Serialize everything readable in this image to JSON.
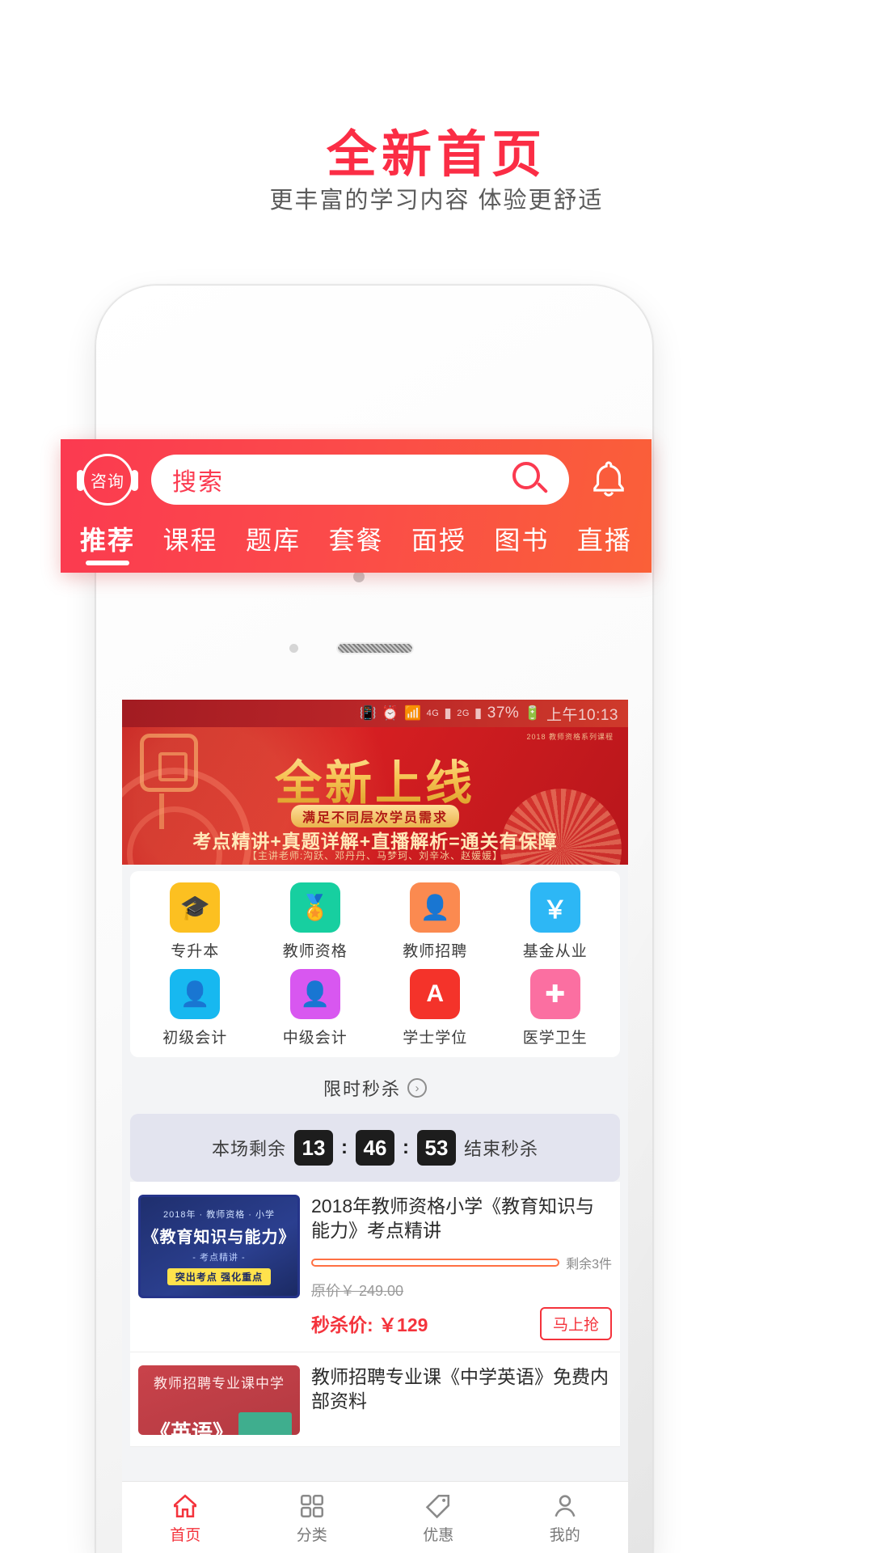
{
  "promo": {
    "title": "全新首页",
    "subtitle": "更丰富的学习内容  体验更舒适",
    "title_color": "#fb2d45"
  },
  "statusbar": {
    "vibrate_icon": "vibrate-icon",
    "alarm_icon": "alarm-icon",
    "wifi_icon": "wifi-icon",
    "net_4g": "4G",
    "net_2g": "2G",
    "battery_percent": "37%",
    "time": "上午10:13"
  },
  "header": {
    "consult_label": "咨询",
    "search_placeholder": "搜索",
    "search_icon": "search-icon",
    "bell_icon": "bell-icon",
    "accent_bg_from": "#fb3a50",
    "accent_bg_to": "#fa6038",
    "tabs": [
      {
        "label": "推荐",
        "active": true
      },
      {
        "label": "课程",
        "active": false
      },
      {
        "label": "题库",
        "active": false
      },
      {
        "label": "套餐",
        "active": false
      },
      {
        "label": "面授",
        "active": false
      },
      {
        "label": "图书",
        "active": false
      },
      {
        "label": "直播",
        "active": false
      }
    ]
  },
  "banner": {
    "top_note": "2018 教师资格系列课程",
    "headline": "全新上线",
    "pill": "满足不同层次学员需求",
    "line": "考点精讲+真题详解+直播解析=通关有保障",
    "teachers": "【主讲老师:沟跃、邓丹丹、马梦珂、刘辛冰、赵媛媛】"
  },
  "grid": [
    {
      "label": "专升本",
      "color": "#fcc021",
      "icon": "graduation-cap-icon",
      "glyph": "🎓"
    },
    {
      "label": "教师资格",
      "color": "#17cfa0",
      "icon": "certificate-icon",
      "glyph": "🏅"
    },
    {
      "label": "教师招聘",
      "color": "#fb8a50",
      "icon": "person-card-icon",
      "glyph": "👤"
    },
    {
      "label": "基金从业",
      "color": "#2db7f5",
      "icon": "yuan-coin-icon",
      "glyph": "￥"
    },
    {
      "label": "初级会计",
      "color": "#17b8f0",
      "icon": "person-id-icon",
      "glyph": "👤"
    },
    {
      "label": "中级会计",
      "color": "#d857f0",
      "icon": "person-tie-icon",
      "glyph": "👤"
    },
    {
      "label": "学士学位",
      "color": "#f4332a",
      "icon": "letter-a-book-icon",
      "glyph": "A"
    },
    {
      "label": "医学卫生",
      "color": "#fb6fa1",
      "icon": "medical-kit-icon",
      "glyph": "✚"
    }
  ],
  "seckill": {
    "title": "限时秒杀",
    "arrow_icon": "chevron-right-icon",
    "remaining_label": "本场剩余",
    "hours": "13",
    "minutes": "46",
    "seconds": "53",
    "separator": ":",
    "end_label": "结束秒杀"
  },
  "products": [
    {
      "thumb_top": "2018年 · 教师资格 · 小学",
      "thumb_main": "《教育知识与能力》",
      "thumb_sub": "- 考点精讲 -",
      "thumb_badge": "突出考点 强化重点",
      "title": "2018年教师资格小学《教育知识与能力》考点精讲",
      "stock": "剩余3件",
      "original_price": "原价￥ 249.00",
      "sale_price": "秒杀价: ￥129",
      "buy_label": "马上抢"
    },
    {
      "thumb_top": "教师招聘专业课中学",
      "thumb_main": "《英语》",
      "title": "教师招聘专业课《中学英语》免费内部资料"
    }
  ],
  "tabbar": [
    {
      "label": "首页",
      "icon": "home-icon",
      "active": true
    },
    {
      "label": "分类",
      "icon": "grid-icon",
      "active": false
    },
    {
      "label": "优惠",
      "icon": "tag-icon",
      "active": false
    },
    {
      "label": "我的",
      "icon": "person-icon",
      "active": false
    }
  ]
}
